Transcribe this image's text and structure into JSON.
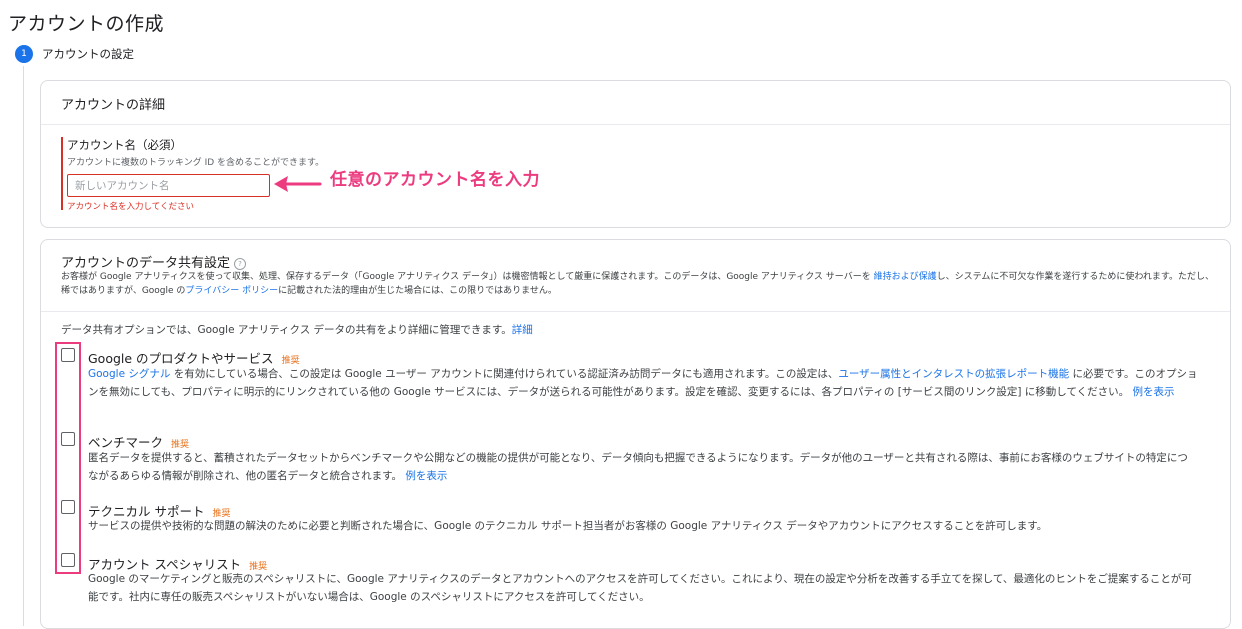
{
  "page_title": "アカウントの作成",
  "step": {
    "number": "1",
    "label": "アカウントの設定"
  },
  "details": {
    "title": "アカウントの詳細",
    "field_label": "アカウント名（必須）",
    "field_help": "アカウントに複数のトラッキング ID を含めることができます。",
    "input_value": "",
    "input_placeholder": "新しいアカウント名",
    "error_text": "アカウント名を入力してください"
  },
  "annotation": {
    "text": "任意のアカウント名を入力",
    "color": "#ec3b7f"
  },
  "sharing": {
    "title": "アカウントのデータ共有設定",
    "help_icon": "?",
    "desc_part1": "お客様が Google アナリティクスを使って収集、処理、保存するデータ（「Google アナリティクス データ」）は機密情報として厳重に保護されます。このデータは、Google アナリティクス サーバーを ",
    "desc_link1": "維持および保護",
    "desc_part2": "し、システムに不可欠な作業を遂行するために使われます。ただし、稀ではありますが、Google の",
    "desc_link2": "プライバシー ポリシー",
    "desc_part3": "に記載された法的理由が生じた場合には、この限りではありません。",
    "options_intro": "データ共有オプションでは、Google アナリティクス データの共有をより詳細に管理できます。",
    "options_intro_link": "詳細",
    "options": [
      {
        "title": "Google のプロダクトやサービス",
        "badge": "推奨",
        "link_a": "Google シグナル",
        "text_a": " を有効にしている場合、この設定は Google ユーザー アカウントに関連付けられている認証済み訪問データにも適用されます。この設定は、",
        "link_b": "ユーザー属性とインタレストの拡張レポート機能",
        "text_b": " に必要です。このオプションを無効にしても、プロパティに明示的にリンクされている他の Google サービスには、データが送られる可能性があります。設定を確認、変更するには、各プロパティの [サービス間のリンク設定] に移動してください。",
        "link_c": "例を表示"
      },
      {
        "title": "ベンチマーク",
        "badge": "推奨",
        "text_a": "匿名データを提供すると、蓄積されたデータセットからベンチマークや公開などの機能の提供が可能となり、データ傾向も把握できるようになります。データが他のユーザーと共有される際は、事前にお客様のウェブサイトの特定につながるあらゆる情報が削除され、他の匿名データと統合されます。",
        "link_c": "例を表示"
      },
      {
        "title": "テクニカル サポート",
        "badge": "推奨",
        "text_a": "サービスの提供や技術的な問題の解決のために必要と判断された場合に、Google のテクニカル サポート担当者がお客様の Google アナリティクス データやアカウントにアクセスすることを許可します。"
      },
      {
        "title": "アカウント スペシャリスト",
        "badge": "推奨",
        "text_a": "Google のマーケティングと販売のスペシャリストに、Google アナリティクスのデータとアカウントへのアクセスを許可してください。これにより、現在の設定や分析を改善する手立てを探して、最適化のヒントをご提案することが可能です。社内に専任の販売スペシャリストがいない場合は、Google のスペシャリストにアクセスを許可してください。"
      }
    ]
  }
}
